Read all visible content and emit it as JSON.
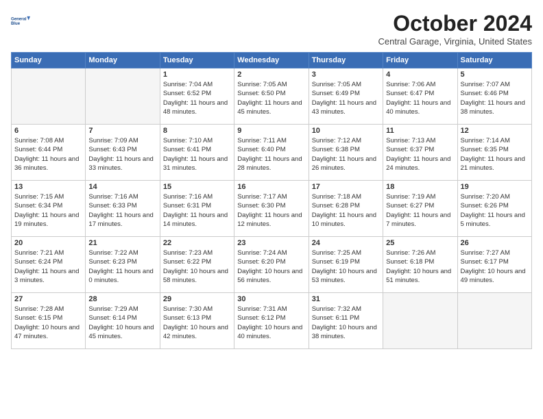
{
  "header": {
    "logo_line1": "General",
    "logo_line2": "Blue",
    "month": "October 2024",
    "location": "Central Garage, Virginia, United States"
  },
  "weekdays": [
    "Sunday",
    "Monday",
    "Tuesday",
    "Wednesday",
    "Thursday",
    "Friday",
    "Saturday"
  ],
  "weeks": [
    [
      {
        "day": "",
        "info": "",
        "empty": true
      },
      {
        "day": "",
        "info": "",
        "empty": true
      },
      {
        "day": "1",
        "info": "Sunrise: 7:04 AM\nSunset: 6:52 PM\nDaylight: 11 hours and 48 minutes."
      },
      {
        "day": "2",
        "info": "Sunrise: 7:05 AM\nSunset: 6:50 PM\nDaylight: 11 hours and 45 minutes."
      },
      {
        "day": "3",
        "info": "Sunrise: 7:05 AM\nSunset: 6:49 PM\nDaylight: 11 hours and 43 minutes."
      },
      {
        "day": "4",
        "info": "Sunrise: 7:06 AM\nSunset: 6:47 PM\nDaylight: 11 hours and 40 minutes."
      },
      {
        "day": "5",
        "info": "Sunrise: 7:07 AM\nSunset: 6:46 PM\nDaylight: 11 hours and 38 minutes."
      }
    ],
    [
      {
        "day": "6",
        "info": "Sunrise: 7:08 AM\nSunset: 6:44 PM\nDaylight: 11 hours and 36 minutes."
      },
      {
        "day": "7",
        "info": "Sunrise: 7:09 AM\nSunset: 6:43 PM\nDaylight: 11 hours and 33 minutes."
      },
      {
        "day": "8",
        "info": "Sunrise: 7:10 AM\nSunset: 6:41 PM\nDaylight: 11 hours and 31 minutes."
      },
      {
        "day": "9",
        "info": "Sunrise: 7:11 AM\nSunset: 6:40 PM\nDaylight: 11 hours and 28 minutes."
      },
      {
        "day": "10",
        "info": "Sunrise: 7:12 AM\nSunset: 6:38 PM\nDaylight: 11 hours and 26 minutes."
      },
      {
        "day": "11",
        "info": "Sunrise: 7:13 AM\nSunset: 6:37 PM\nDaylight: 11 hours and 24 minutes."
      },
      {
        "day": "12",
        "info": "Sunrise: 7:14 AM\nSunset: 6:35 PM\nDaylight: 11 hours and 21 minutes."
      }
    ],
    [
      {
        "day": "13",
        "info": "Sunrise: 7:15 AM\nSunset: 6:34 PM\nDaylight: 11 hours and 19 minutes."
      },
      {
        "day": "14",
        "info": "Sunrise: 7:16 AM\nSunset: 6:33 PM\nDaylight: 11 hours and 17 minutes."
      },
      {
        "day": "15",
        "info": "Sunrise: 7:16 AM\nSunset: 6:31 PM\nDaylight: 11 hours and 14 minutes."
      },
      {
        "day": "16",
        "info": "Sunrise: 7:17 AM\nSunset: 6:30 PM\nDaylight: 11 hours and 12 minutes."
      },
      {
        "day": "17",
        "info": "Sunrise: 7:18 AM\nSunset: 6:28 PM\nDaylight: 11 hours and 10 minutes."
      },
      {
        "day": "18",
        "info": "Sunrise: 7:19 AM\nSunset: 6:27 PM\nDaylight: 11 hours and 7 minutes."
      },
      {
        "day": "19",
        "info": "Sunrise: 7:20 AM\nSunset: 6:26 PM\nDaylight: 11 hours and 5 minutes."
      }
    ],
    [
      {
        "day": "20",
        "info": "Sunrise: 7:21 AM\nSunset: 6:24 PM\nDaylight: 11 hours and 3 minutes."
      },
      {
        "day": "21",
        "info": "Sunrise: 7:22 AM\nSunset: 6:23 PM\nDaylight: 11 hours and 0 minutes."
      },
      {
        "day": "22",
        "info": "Sunrise: 7:23 AM\nSunset: 6:22 PM\nDaylight: 10 hours and 58 minutes."
      },
      {
        "day": "23",
        "info": "Sunrise: 7:24 AM\nSunset: 6:20 PM\nDaylight: 10 hours and 56 minutes."
      },
      {
        "day": "24",
        "info": "Sunrise: 7:25 AM\nSunset: 6:19 PM\nDaylight: 10 hours and 53 minutes."
      },
      {
        "day": "25",
        "info": "Sunrise: 7:26 AM\nSunset: 6:18 PM\nDaylight: 10 hours and 51 minutes."
      },
      {
        "day": "26",
        "info": "Sunrise: 7:27 AM\nSunset: 6:17 PM\nDaylight: 10 hours and 49 minutes."
      }
    ],
    [
      {
        "day": "27",
        "info": "Sunrise: 7:28 AM\nSunset: 6:15 PM\nDaylight: 10 hours and 47 minutes."
      },
      {
        "day": "28",
        "info": "Sunrise: 7:29 AM\nSunset: 6:14 PM\nDaylight: 10 hours and 45 minutes."
      },
      {
        "day": "29",
        "info": "Sunrise: 7:30 AM\nSunset: 6:13 PM\nDaylight: 10 hours and 42 minutes."
      },
      {
        "day": "30",
        "info": "Sunrise: 7:31 AM\nSunset: 6:12 PM\nDaylight: 10 hours and 40 minutes."
      },
      {
        "day": "31",
        "info": "Sunrise: 7:32 AM\nSunset: 6:11 PM\nDaylight: 10 hours and 38 minutes."
      },
      {
        "day": "",
        "info": "",
        "empty": true
      },
      {
        "day": "",
        "info": "",
        "empty": true
      }
    ]
  ]
}
